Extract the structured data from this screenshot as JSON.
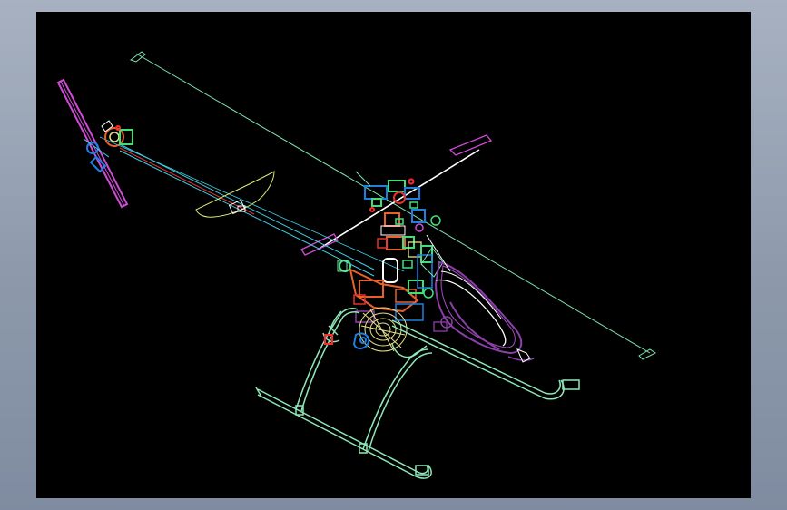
{
  "window": {
    "background": "#98a3b5",
    "viewport_background": "#000000"
  },
  "drawing": {
    "subject": "helicopter-wireframe",
    "layer_colors": {
      "main_rotor": "#7ee6b0",
      "tail_boom": "#3fd0e8",
      "tail_rotor": "#d24bd8",
      "skids": "#8fe8b8",
      "canopy": "#8b3fa8",
      "canopy_outline": "#ffffff",
      "engine": "#e8e08a",
      "frame": "#e8602a",
      "hub": "#1f7fe0",
      "fin": "#d8f07a",
      "accent": "#ff2a2a"
    }
  }
}
